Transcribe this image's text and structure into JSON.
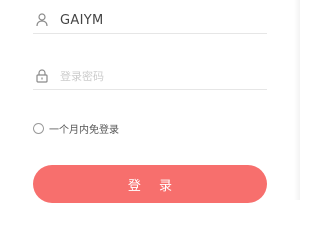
{
  "login_form": {
    "username": {
      "icon": "user-icon",
      "value": "GAIYM"
    },
    "password": {
      "icon": "lock-icon",
      "placeholder": "登录密码"
    },
    "remember": {
      "label": "一个月内免登录",
      "checked": false
    },
    "submit": {
      "label": "登 录"
    }
  },
  "colors": {
    "accent": "#f76f6d",
    "divider": "#e6e6e6",
    "icon": "#8a8a8a"
  }
}
